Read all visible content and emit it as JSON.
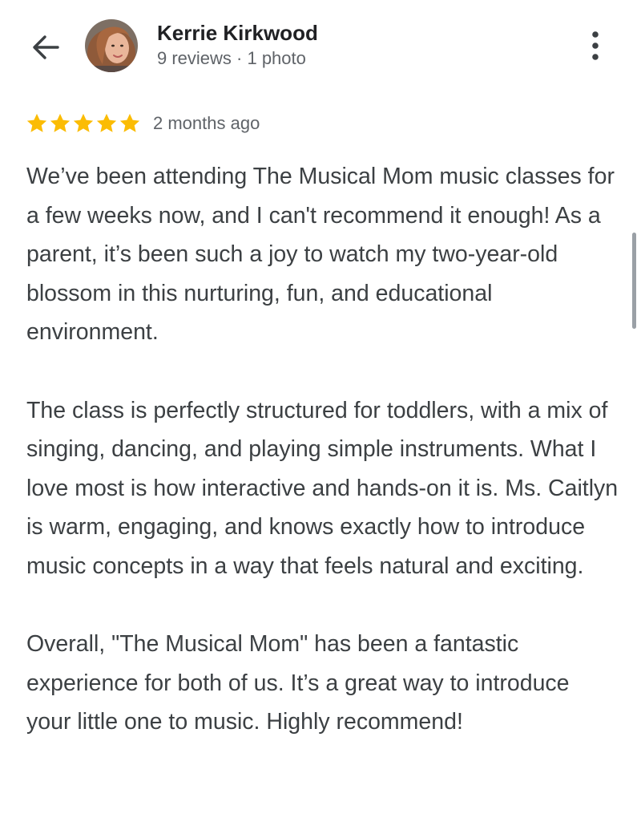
{
  "header": {
    "back_icon": "arrow-left-icon",
    "reviewer_name": "Kerrie Kirkwood",
    "reviewer_meta": "9 reviews · 1 photo",
    "more_icon": "more-vertical-icon"
  },
  "review": {
    "rating": 5,
    "max_rating": 5,
    "star_color": "#fbbc04",
    "date": "2 months ago",
    "paragraphs": [
      "We’ve been attending The Musical Mom music classes for a few weeks now, and I can't recommend it enough! As a parent, it’s been such a joy to watch my two-year-old blossom in this nurturing, fun, and educational environment.",
      "The class is perfectly structured for toddlers, with a mix of singing, dancing, and playing simple instruments. What I love most is how interactive and hands-on it is. Ms. Caitlyn is warm, engaging, and knows exactly how to introduce music concepts in a way that feels natural and exciting.",
      "Overall, \"The Musical Mom\" has been a fantastic experience for both of us. It’s a great way to introduce your little one to music. Highly recommend!"
    ]
  }
}
